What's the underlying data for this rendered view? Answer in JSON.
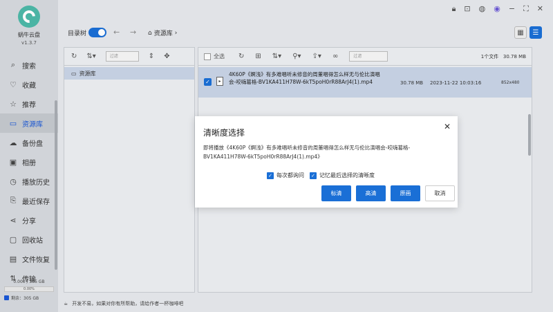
{
  "app": {
    "name": "蜗牛云盘",
    "version": "v1.3.7"
  },
  "sidebar": {
    "items": [
      {
        "label": "搜索",
        "icon": "search-icon",
        "glyph": "⌕"
      },
      {
        "label": "收藏",
        "icon": "heart-icon",
        "glyph": "♡"
      },
      {
        "label": "推荐",
        "icon": "star-icon",
        "glyph": "☆"
      },
      {
        "label": "资源库",
        "icon": "folder-icon",
        "glyph": "▭",
        "active": true
      },
      {
        "label": "备份盘",
        "icon": "cloud-icon",
        "glyph": "☁"
      },
      {
        "label": "相册",
        "icon": "photo-icon",
        "glyph": "▣"
      },
      {
        "label": "播放历史",
        "icon": "history-icon",
        "glyph": "◷"
      },
      {
        "label": "最近保存",
        "icon": "save-icon",
        "glyph": "⎘"
      },
      {
        "label": "分享",
        "icon": "share-icon",
        "glyph": "⋖"
      },
      {
        "label": "回收站",
        "icon": "trash-icon",
        "glyph": "▢"
      },
      {
        "label": "文件恢复",
        "icon": "restore-icon",
        "glyph": "▤"
      },
      {
        "label": "传输",
        "icon": "transfer-icon",
        "glyph": "⇅"
      }
    ],
    "storage_used": "0.000 / 305 GB",
    "storage_percent": "0.00%",
    "storage_free": "剩余：305 GB"
  },
  "topbar": {
    "tree_label": "目录树",
    "tree_toggle_on": true,
    "breadcrumb": "资源库"
  },
  "left_pane": {
    "search_placeholder": "过滤",
    "folder": "资源库"
  },
  "right_pane": {
    "select_all": "全选",
    "search_placeholder": "过滤",
    "count_text": "1个文件",
    "total_size": "30.78 MB",
    "file": {
      "name": "4K60P《婀浅》有多难唱听未修音的周董唱得怎么样无与伦比演唱会-咬嗨葛格-BV1KA411H78W-6kT5poH0rR88ArJ4(1).mp4",
      "size": "30.78 MB",
      "date": "2023-11-22 10:03:16",
      "resolution": "852x480"
    }
  },
  "statusbar": {
    "text": "开发不易，如果对你有所帮助，请给作者一杯咖啡吧"
  },
  "dialog": {
    "title": "清晰度选择",
    "message": "即将播放《4K60P《婀浅》有多难唱听未修音的周董唱得怎么样无与伦比演唱会-咬嗨葛格-BV1KA411H78W-6kT5poH0rR88ArJ4(1).mp4》",
    "check1": "每次都询问",
    "check2": "记忆最后选择的清晰度",
    "btn_standard": "标清",
    "btn_high": "高清",
    "btn_original": "原画",
    "btn_cancel": "取消"
  },
  "colors": {
    "accent": "#1a6fd6",
    "selected_row": "#c8d4e6"
  }
}
